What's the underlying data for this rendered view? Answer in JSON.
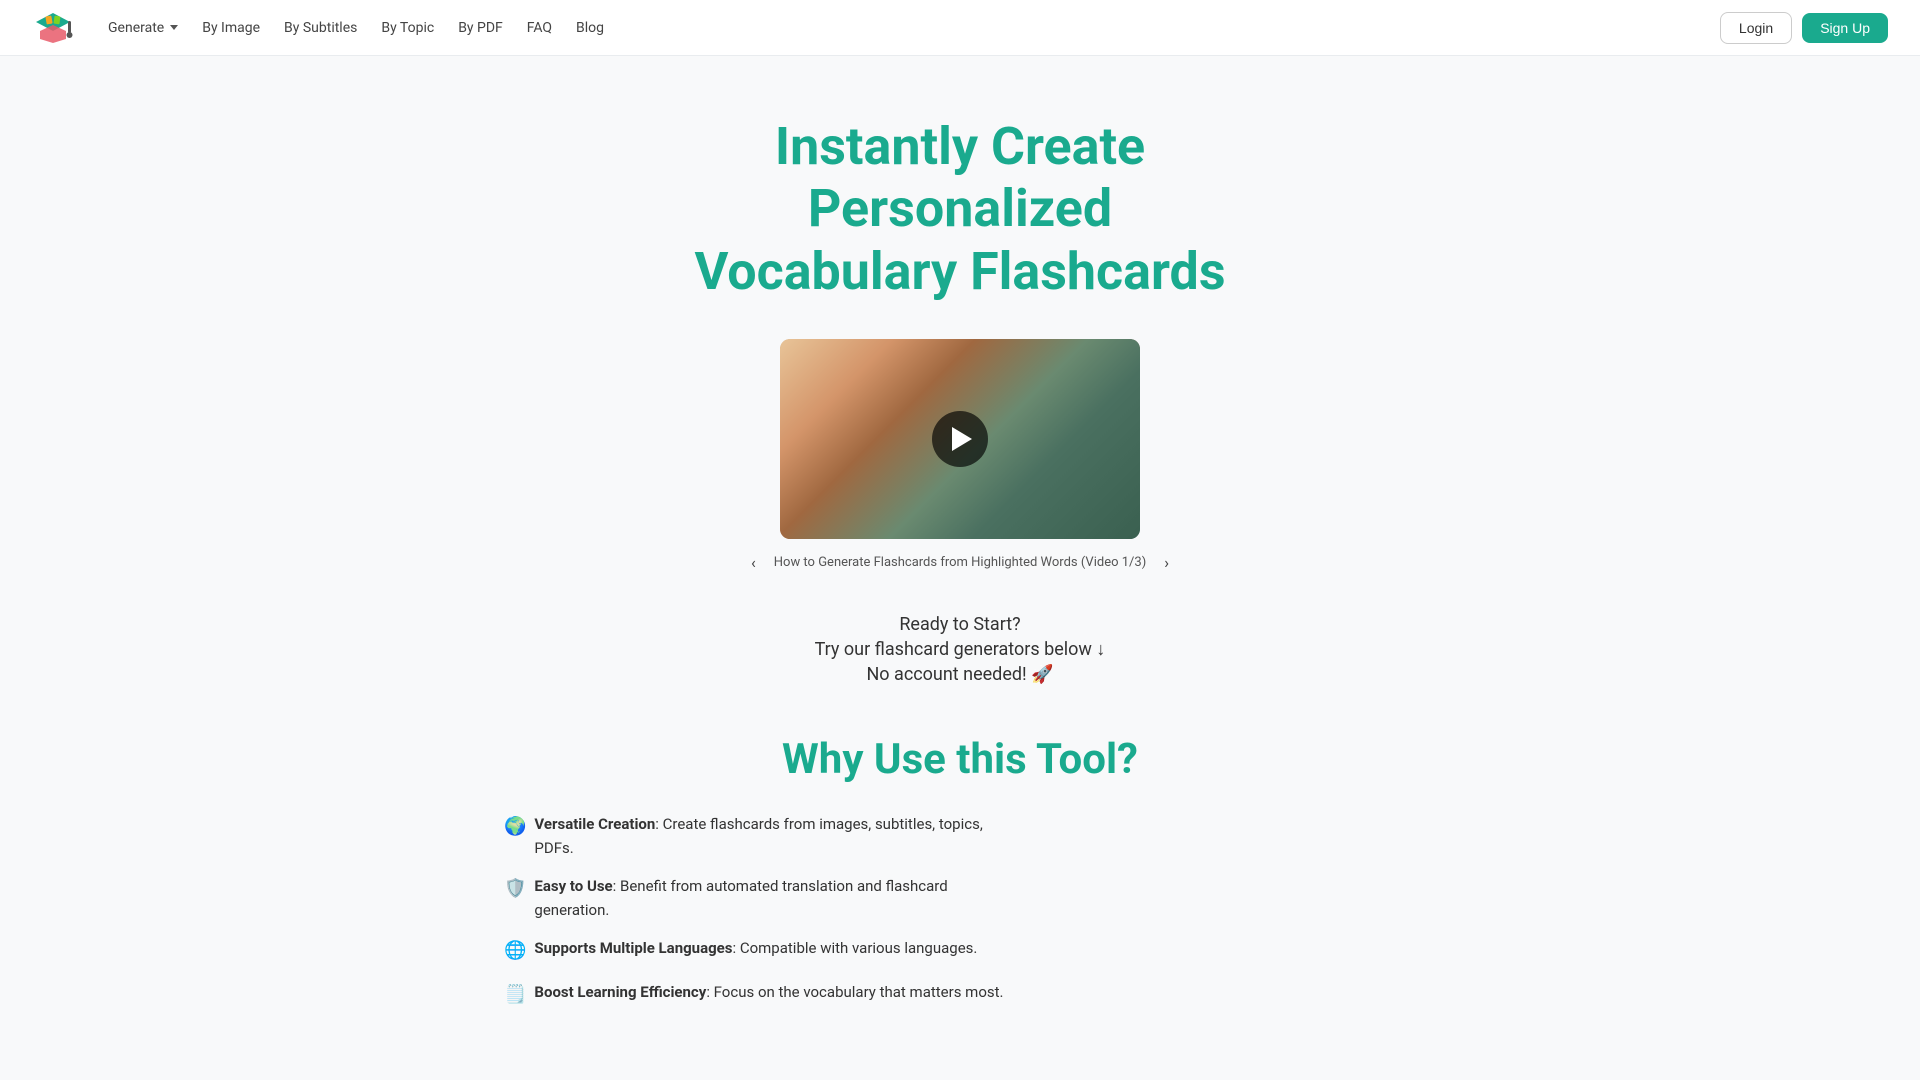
{
  "nav": {
    "generate_label": "Generate",
    "by_image_label": "By Image",
    "by_subtitles_label": "By Subtitles",
    "by_topic_label": "By Topic",
    "by_pdf_label": "By PDF",
    "faq_label": "FAQ",
    "blog_label": "Blog",
    "login_label": "Login",
    "signup_label": "Sign Up"
  },
  "hero": {
    "title_line1": "Instantly Create",
    "title_line2": "Personalized",
    "title_line3": "Vocabulary Flashcards"
  },
  "video": {
    "caption": "How to Generate Flashcards from Highlighted Words (Video 1/3)"
  },
  "cta": {
    "line1": "Ready to Start?",
    "line2": "Try our flashcard generators below ↓",
    "line3": "No account needed! 🚀"
  },
  "why": {
    "title": "Why Use this Tool?",
    "features": [
      {
        "icon": "🌍",
        "title": "Versatile Creation",
        "desc": ": Create flashcards from images, subtitles, topics, PDFs."
      },
      {
        "icon": "🛡️",
        "title": "Easy to Use",
        "desc": ": Benefit from automated translation and flashcard generation."
      },
      {
        "icon": "🌐",
        "title": "Supports Multiple Languages",
        "desc": ": Compatible with various languages."
      },
      {
        "icon": "🗒️",
        "title": "Boost Learning Efficiency",
        "desc": ": Focus on the vocabulary that matters most."
      }
    ]
  }
}
